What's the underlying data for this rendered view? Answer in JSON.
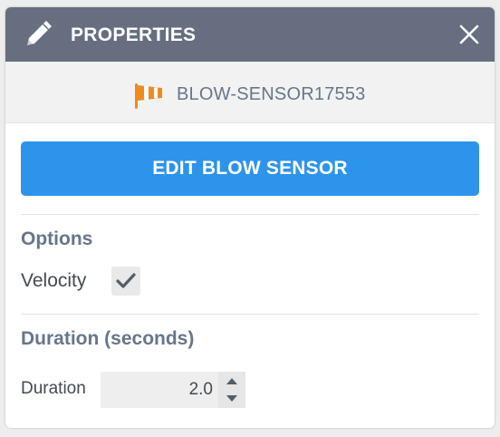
{
  "header": {
    "title": "PROPERTIES"
  },
  "sensor": {
    "name": "BLOW-SENSOR17553",
    "icon": "windsock-icon",
    "icon_color": "#f08a1f"
  },
  "actions": {
    "edit_label": "EDIT BLOW SENSOR"
  },
  "options": {
    "title": "Options",
    "velocity_label": "Velocity",
    "velocity_checked": true
  },
  "duration": {
    "title": "Duration (seconds)",
    "label": "Duration",
    "value": "2.0"
  },
  "colors": {
    "header_bg": "#666e80",
    "accent": "#2d94ec",
    "section_text": "#67768a"
  }
}
